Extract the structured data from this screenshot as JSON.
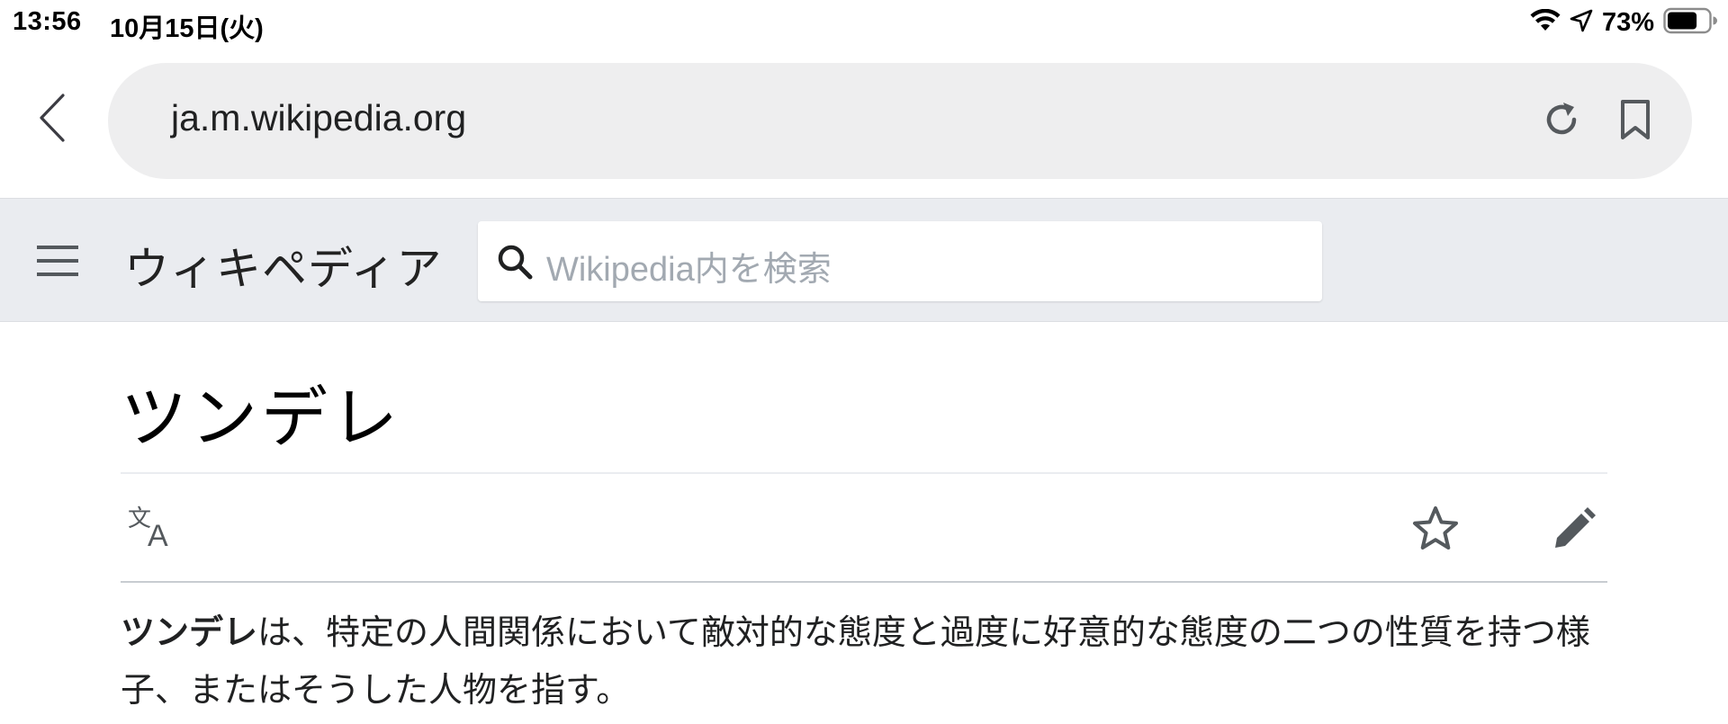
{
  "status_bar": {
    "time": "13:56",
    "date": "10月15日(火)",
    "battery_percent": "73%",
    "battery_level": 0.73,
    "icons": [
      "wifi-icon",
      "location-arrow-icon",
      "battery-icon"
    ]
  },
  "browser": {
    "url": "ja.m.wikipedia.org",
    "icons": [
      "chevron-left-icon",
      "reload-icon",
      "bookmark-icon"
    ]
  },
  "wiki_header": {
    "wordmark": "ウィキペディア",
    "search_placeholder": "Wikipedia内を検索",
    "icons": [
      "hamburger-menu-icon",
      "search-icon"
    ]
  },
  "article": {
    "title": "ツンデレ",
    "actions": [
      "language-icon",
      "star-icon",
      "pencil-icon"
    ],
    "lead_bold": "ツンデレ",
    "lead_text_line1": "は、特定の人間関係において敵対的な態度と過度に好意的な態度の二つの性質を持つ様",
    "lead_text_line2": "子、またはそうした人物を指す。"
  },
  "colors": {
    "wiki_header_bg": "#eaecf0",
    "url_pill_bg": "#eeeeef",
    "icon_gray": "#54595d",
    "placeholder_gray": "#a2a9b1"
  }
}
